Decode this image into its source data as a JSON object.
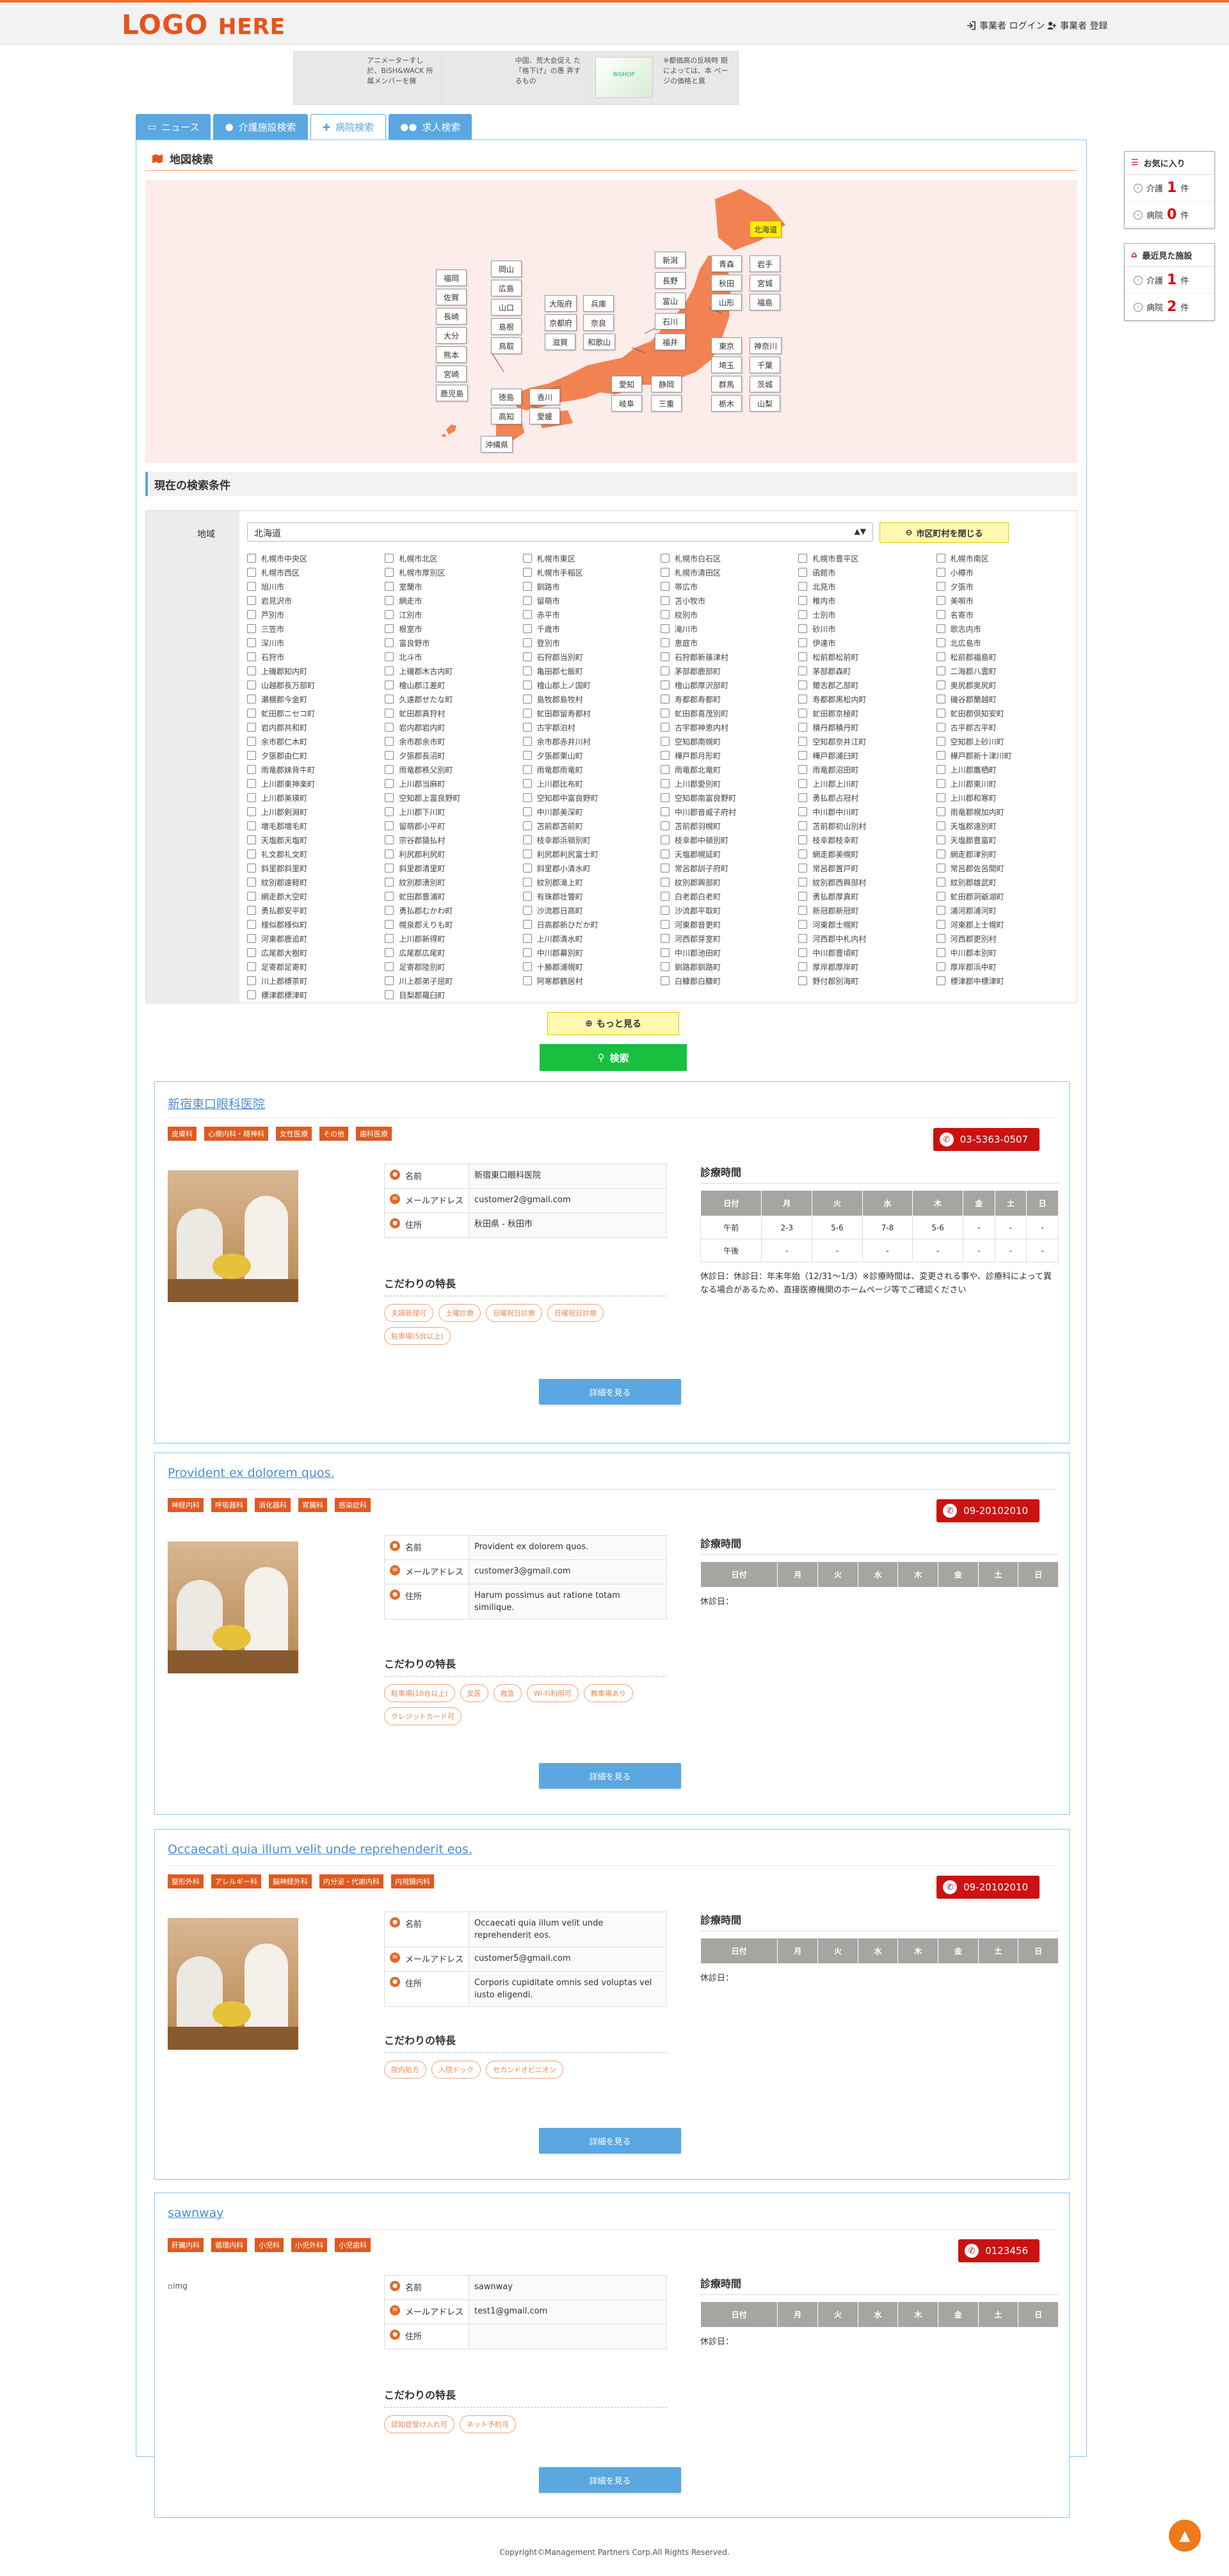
{
  "header": {
    "logo_main": "LOGO",
    "logo_sub": "HERE",
    "login": "事業者 ログイン",
    "register": "事業者 登録"
  },
  "ads": [
    {
      "text": "アニメーターすし 於、BiSH&WACK 所属メンバーを擁"
    },
    {
      "text": "中国、荒大会促え た「格下げ」の愚 弄するもの"
    },
    {
      "text": "※都価高の反映時 期によっては、本 ページの価格と異",
      "thumb": "BISHOP"
    }
  ],
  "tabs": [
    {
      "label": "ニュース"
    },
    {
      "label": "介護施設検索"
    },
    {
      "label": "病院検索"
    },
    {
      "label": "求人検索"
    }
  ],
  "map_section": {
    "title": "地図検索"
  },
  "prefectures": {
    "hokkaido": "北海道",
    "aomori": "青森",
    "iwate": "岩手",
    "akita": "秋田",
    "miyagi": "宮城",
    "yamagata": "山形",
    "fukushima": "福島",
    "niigata": "新潟",
    "nagano": "長野",
    "toyama": "富山",
    "ishikawa": "石川",
    "fukui": "福井",
    "tokyo": "東京",
    "kanagawa": "神奈川",
    "saitama": "埼玉",
    "chiba": "千葉",
    "gunma": "群馬",
    "ibaraki": "茨城",
    "tochigi": "栃木",
    "yamanashi": "山梨",
    "aichi": "愛知",
    "shizuoka": "静岡",
    "gifu": "岐阜",
    "mie": "三重",
    "osaka": "大阪府",
    "hyogo": "兵庫",
    "kyoto": "京都府",
    "nara": "奈良",
    "shiga": "滋賀",
    "wakayama": "和歌山",
    "okayama": "岡山",
    "hiroshima": "広島",
    "yamaguchi": "山口",
    "shimane": "島根",
    "tottori": "鳥取",
    "tokushima": "徳島",
    "kagawa": "香川",
    "kochi": "高知",
    "ehime": "愛媛",
    "fukuoka": "福岡",
    "saga": "佐賀",
    "nagasaki": "長崎",
    "oita": "大分",
    "kumamoto": "熊本",
    "miyazaki": "宮崎",
    "kagoshima": "鹿児島",
    "okinawa": "沖縄県"
  },
  "conditions": {
    "title": "現在の検索条件",
    "area_label": "地域",
    "selected": "北海道",
    "close_button": "市区町村を閉じる"
  },
  "cities": [
    "札幌市中央区",
    "札幌市北区",
    "札幌市東区",
    "札幌市白石区",
    "札幌市豊平区",
    "札幌市南区",
    "札幌市西区",
    "札幌市厚別区",
    "札幌市手稲区",
    "札幌市清田区",
    "函館市",
    "小樽市",
    "旭川市",
    "室蘭市",
    "釧路市",
    "帯広市",
    "北見市",
    "夕張市",
    "岩見沢市",
    "網走市",
    "留萌市",
    "苫小牧市",
    "稚内市",
    "美唄市",
    "芦別市",
    "江別市",
    "赤平市",
    "紋別市",
    "士別市",
    "名寄市",
    "三笠市",
    "根室市",
    "千歳市",
    "滝川市",
    "砂川市",
    "歌志内市",
    "深川市",
    "富良野市",
    "登別市",
    "恵庭市",
    "伊達市",
    "北広島市",
    "石狩市",
    "北斗市",
    "石狩郡当別町",
    "石狩郡新篠津村",
    "松前郡松前町",
    "松前郡福島町",
    "上磯郡知内町",
    "上磯郡木古内町",
    "亀田郡七飯町",
    "茅部郡鹿部町",
    "茅部郡森町",
    "二海郡八雲町",
    "山越郡長万部町",
    "檜山郡江差町",
    "檜山郡上ノ国町",
    "檜山郡厚沢部町",
    "爾志郡乙部町",
    "奥尻郡奥尻町",
    "瀬棚郡今金町",
    "久遠郡せたな町",
    "島牧郡島牧村",
    "寿都郡寿都町",
    "寿都郡黒松内町",
    "磯谷郡蘭越町",
    "虻田郡ニセコ町",
    "虻田郡真狩村",
    "虻田郡留寿都村",
    "虻田郡喜茂別町",
    "虻田郡京極町",
    "虻田郡倶知安町",
    "岩内郡共和町",
    "岩内郡岩内町",
    "古宇郡泊村",
    "古宇郡神恵内村",
    "積丹郡積丹町",
    "古平郡古平町",
    "余市郡仁木町",
    "余市郡余市町",
    "余市郡赤井川村",
    "空知郡南幌町",
    "空知郡奈井江町",
    "空知郡上砂川町",
    "夕張郡由仁町",
    "夕張郡長沼町",
    "夕張郡栗山町",
    "樺戸郡月形町",
    "樺戸郡浦臼町",
    "樺戸郡新十津川町",
    "雨竜郡妹背牛町",
    "雨竜郡秩父別町",
    "雨竜郡雨竜町",
    "雨竜郡北竜町",
    "雨竜郡沼田町",
    "上川郡鷹栖町",
    "上川郡東神楽町",
    "上川郡当麻町",
    "上川郡比布町",
    "上川郡愛別町",
    "上川郡上川町",
    "上川郡東川町",
    "上川郡美瑛町",
    "空知郡上富良野町",
    "空知郡中富良野町",
    "空知郡南富良野町",
    "勇払郡占冠村",
    "上川郡和寒町",
    "上川郡剣淵町",
    "上川郡下川町",
    "中川郡美深町",
    "中川郡音威子府村",
    "中川郡中川町",
    "雨竜郡幌加内町",
    "増毛郡増毛町",
    "留萌郡小平町",
    "苫前郡苫前町",
    "苫前郡羽幌町",
    "苫前郡初山別村",
    "天塩郡遠別町",
    "天塩郡天塩町",
    "宗谷郡猿払村",
    "枝幸郡浜頓別町",
    "枝幸郡中頓別町",
    "枝幸郡枝幸町",
    "天塩郡豊富町",
    "礼文郡礼文町",
    "利尻郡利尻町",
    "利尻郡利尻富士町",
    "天塩郡幌延町",
    "網走郡美幌町",
    "網走郡津別町",
    "斜里郡斜里町",
    "斜里郡清里町",
    "斜里郡小清水町",
    "常呂郡訓子府町",
    "常呂郡置戸町",
    "常呂郡佐呂間町",
    "紋別郡遠軽町",
    "紋別郡湧別町",
    "紋別郡滝上町",
    "紋別郡興部町",
    "紋別郡西興部村",
    "紋別郡雄武町",
    "網走郡大空町",
    "虻田郡豊浦町",
    "有珠郡壮瞥町",
    "白老郡白老町",
    "勇払郡厚真町",
    "虻田郡洞爺湖町",
    "勇払郡安平町",
    "勇払郡むかわ町",
    "沙流郡日高町",
    "沙流郡平取町",
    "新冠郡新冠町",
    "浦河郡浦河町",
    "様似郡様似町",
    "幌泉郡えりも町",
    "日高郡新ひだか町",
    "河東郡音更町",
    "河東郡士幌町",
    "河東郡上士幌町",
    "河東郡鹿追町",
    "上川郡新得町",
    "上川郡清水町",
    "河西郡芽室町",
    "河西郡中札内村",
    "河西郡更別村",
    "広尾郡大樹町",
    "広尾郡広尾町",
    "中川郡幕別町",
    "中川郡池田町",
    "中川郡豊頃町",
    "中川郡本別町",
    "足寄郡足寄町",
    "足寄郡陸別町",
    "十勝郡浦幌町",
    "釧路郡釧路町",
    "厚岸郡厚岸町",
    "厚岸郡浜中町",
    "川上郡標茶町",
    "川上郡弟子屈町",
    "阿寒郡鶴居村",
    "白糠郡白糠町",
    "野付郡別海町",
    "標津郡中標津町",
    "標津郡標津町",
    "目梨郡羅臼町"
  ],
  "buttons": {
    "more": "もっと見る",
    "search": "検索",
    "detail": "詳細を見る"
  },
  "clinics": [
    {
      "name": "新宿東口眼科医院",
      "tags": [
        "皮膚科",
        "心療内科・精神科",
        "女性医療",
        "その他",
        "歯科医療"
      ],
      "phone": "03-5363-0507",
      "fields": {
        "name_label": "名前",
        "name": "新宿東口眼科医院",
        "email_label": "メールアドレス",
        "email": "customer2@gmail.com",
        "address_label": "住所",
        "address": "秋田県 - 秋田市"
      },
      "features_title": "こだわりの特長",
      "features": [
        "夫婦管理可",
        "土曜診療",
        "日曜祝日診療",
        "日曜祝日診療",
        "駐車場(5台以上)"
      ],
      "schedule_title": "診療時間",
      "schedule_note": "休診日：休診日：年末年始（12/31〜1/3）※診療時間は、変更される事や、診療科によって異なる場合があるため、直接医療機関のホームページ等でご確認ください"
    },
    {
      "name": "Provident ex dolorem quos.",
      "tags": [
        "神経内科",
        "呼吸器科",
        "消化器科",
        "胃腸科",
        "感染症科"
      ],
      "phone": "09-20102010",
      "fields": {
        "name_label": "名前",
        "name": "Provident ex dolorem quos.",
        "email_label": "メールアドレス",
        "email": "customer3@gmail.com",
        "address_label": "住所",
        "address": "Harum possimus aut ratione totam similique."
      },
      "features_title": "こだわりの特長",
      "features": [
        "駐車場(10台以上)",
        "女医",
        "救急",
        "Wi-Fi利用可",
        "敷車場あり",
        "クレジットカード可"
      ],
      "schedule_title": "診療時間",
      "schedule_note": "休診日："
    },
    {
      "name": "Occaecati quia illum velit unde reprehenderit eos.",
      "tags": [
        "整形外科",
        "アレルギー科",
        "脳神経外科",
        "内分泌・代謝内科",
        "内視鏡内科"
      ],
      "phone": "09-20102010",
      "fields": {
        "name_label": "名前",
        "name": "Occaecati quia illum velit unde reprehenderit eos.",
        "email_label": "メールアドレス",
        "email": "customer5@gmail.com",
        "address_label": "住所",
        "address": "Corporis cupiditate omnis sed voluptas vel iusto eligendi."
      },
      "features_title": "こだわりの特長",
      "features": [
        "院内処方",
        "入院ドック",
        "セカンドオピニオン"
      ],
      "schedule_title": "診療時間",
      "schedule_note": "休診日："
    },
    {
      "name": "sawnway",
      "tags": [
        "肝臓内科",
        "循環内科",
        "小児科",
        "小児外科",
        "小児歯科"
      ],
      "phone": "0123456",
      "no_image": "img",
      "fields": {
        "name_label": "名前",
        "name": "sawnway",
        "email_label": "メールアドレス",
        "email": "test1@gmail.com",
        "address_label": "住所",
        "address": ""
      },
      "features_title": "こだわりの特長",
      "features": [
        "認知症受け入れ可",
        "ネット予約可"
      ],
      "schedule_title": "診療時間",
      "schedule_note": "休診日："
    }
  ],
  "schedule": {
    "headers": [
      "日付",
      "月",
      "火",
      "水",
      "木",
      "金",
      "土",
      "日"
    ],
    "rows": [
      [
        "午前",
        "2-3",
        "5-6",
        "7-8",
        "5-6",
        "-",
        "-",
        "-"
      ],
      [
        "午後",
        "-",
        "-",
        "-",
        "-",
        "-",
        "-",
        "-"
      ]
    ]
  },
  "sidebar": {
    "favorites_title": "お気に入り",
    "recent_title": "最近見た施設",
    "care_label": "介護",
    "hospital_label": "病院",
    "unit": "件",
    "fav_care": "1",
    "fav_hospital": "0",
    "recent_care": "1",
    "recent_hospital": "2"
  },
  "footer": {
    "copyright": "Copyright©Management Partners Corp.All Rights Reserved."
  },
  "colors": {
    "accent": "#f26b21",
    "link": "#4a90d9",
    "tab": "#5aa7e2",
    "map_fill": "#f38252",
    "tag": "#e05a1e",
    "phone": "#cc1111",
    "search": "#18c03f"
  }
}
